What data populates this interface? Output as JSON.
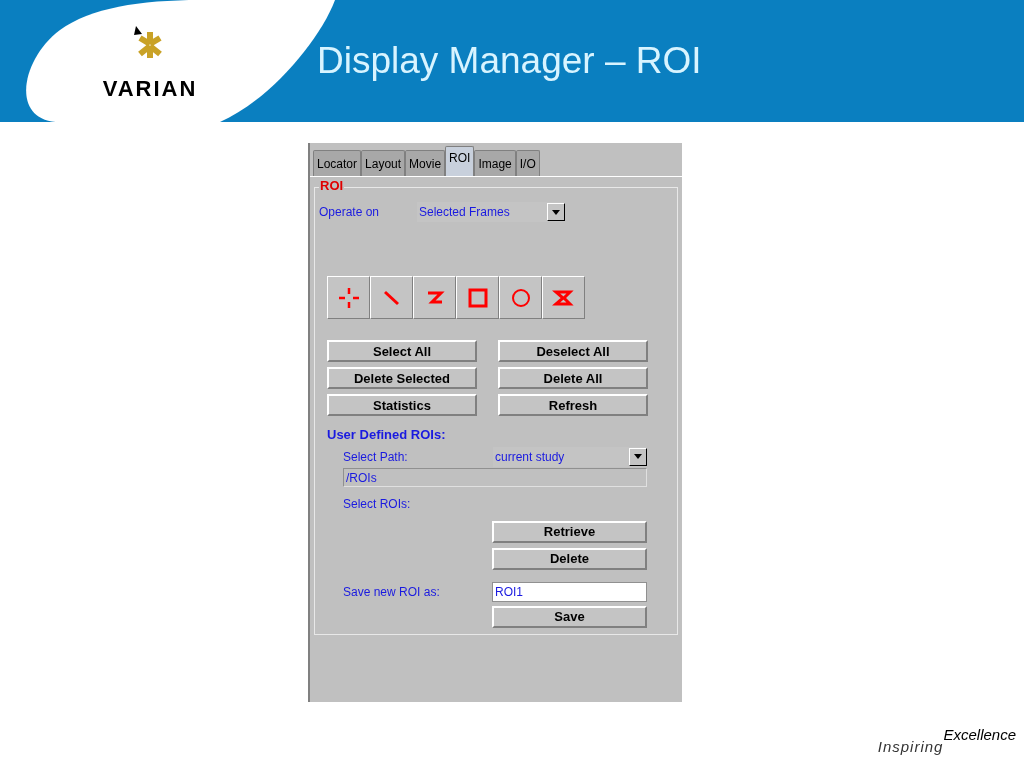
{
  "slide": {
    "title": "Display Manager – ROI",
    "logo_text": "VARIAN",
    "tagline": {
      "first": "Inspiring",
      "second": "Excellence"
    }
  },
  "tabs": [
    {
      "label": "Locator",
      "selected": false
    },
    {
      "label": "Layout",
      "selected": false
    },
    {
      "label": "Movie",
      "selected": false
    },
    {
      "label": "ROI",
      "selected": true
    },
    {
      "label": "Image",
      "selected": false
    },
    {
      "label": "I/O",
      "selected": false
    }
  ],
  "group": {
    "title": "ROI",
    "operate_label": "Operate on",
    "operate_value": "Selected Frames"
  },
  "action_buttons": [
    "Select All",
    "Deselect All",
    "Delete Selected",
    "Delete All",
    "Statistics",
    "Refresh"
  ],
  "user_defined": {
    "heading": "User Defined ROIs:",
    "path_label": "Select Path:",
    "path_value": "current study",
    "path_field": "/ROIs",
    "select_label": "Select ROIs:",
    "retrieve": "Retrieve",
    "delete": "Delete",
    "save_label": "Save new ROI as:",
    "save_value": "ROI1",
    "save": "Save"
  }
}
